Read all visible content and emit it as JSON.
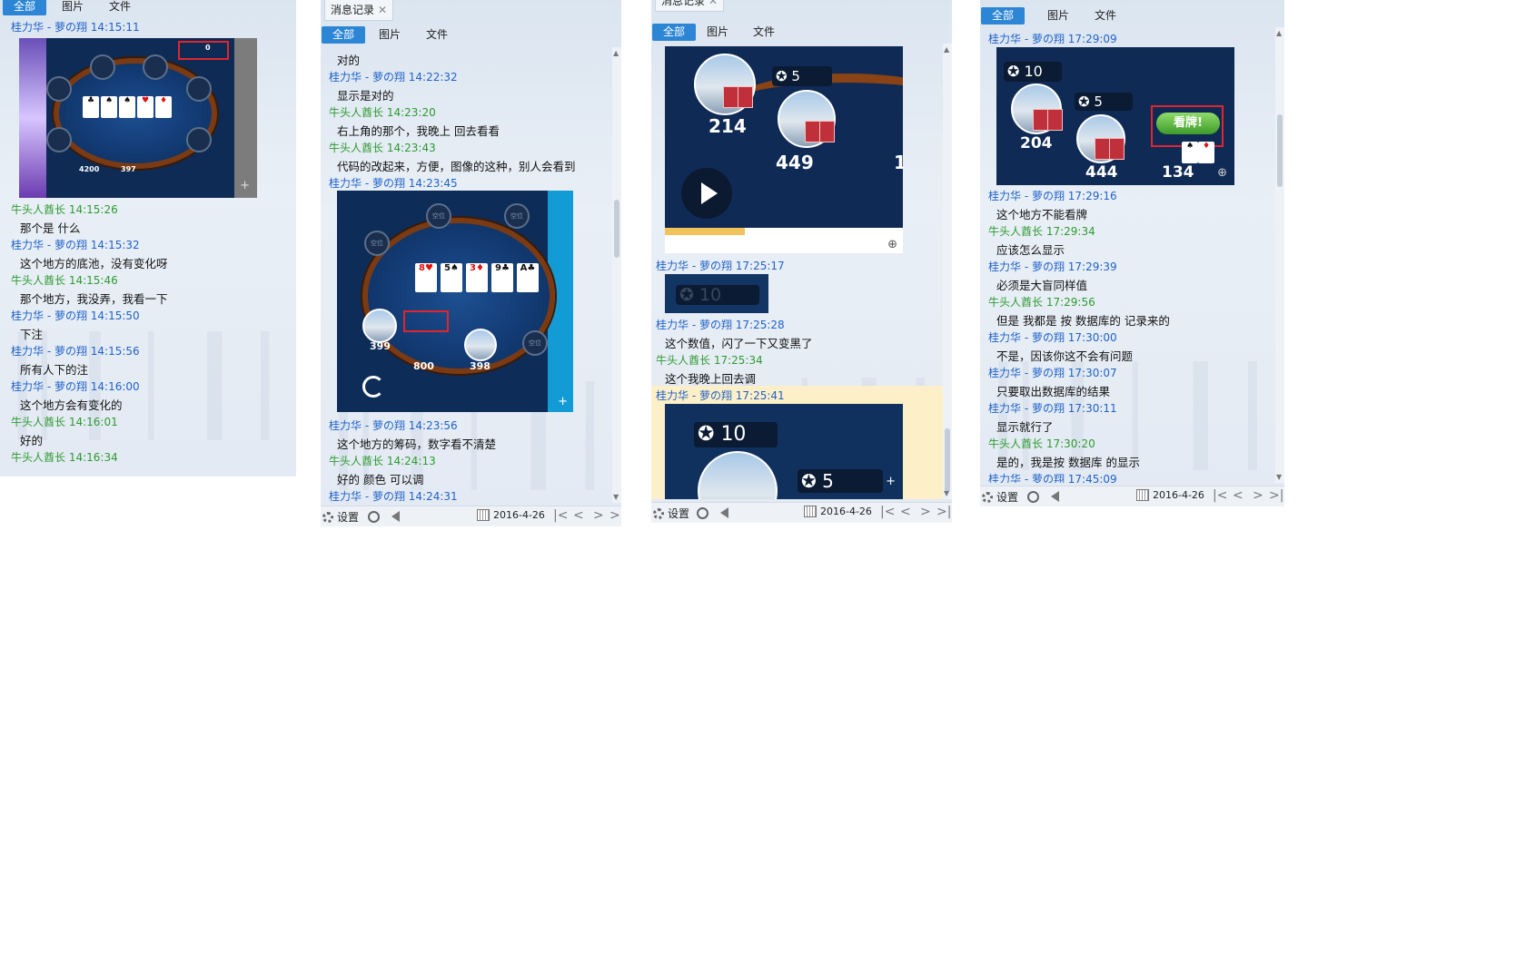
{
  "panels": [
    {
      "title": "",
      "tabs": [
        "全部",
        "图片",
        "文件"
      ],
      "messages": [
        {
          "sender": "桂力华 - 萝の翔 14:15:11",
          "text": ""
        },
        {
          "sender": "牛头人酋长 14:15:26",
          "text": "那个是 什么"
        },
        {
          "sender": "桂力华 - 萝の翔 14:15:32",
          "text": "这个地方的底池，没有变化呀"
        },
        {
          "sender": "牛头人酋长 14:15:46",
          "text": "那个地方，我没弄，我看一下"
        },
        {
          "sender": "桂力华 - 萝の翔 14:15:50",
          "text": "下注"
        },
        {
          "sender": "桂力华 - 萝の翔 14:15:56",
          "text": "所有人下的注"
        },
        {
          "sender": "桂力华 - 萝の翔 14:16:00",
          "text": "这个地方会有变化的"
        },
        {
          "sender": "牛头人酋长 14:16:01",
          "text": "好的"
        },
        {
          "sender": "牛头人酋长 14:16:34",
          "text": ""
        }
      ],
      "image": {
        "chip_total": "4200",
        "pot": "397",
        "topbox": "0"
      }
    },
    {
      "title": "消息记录",
      "tabs": [
        "全部",
        "图片",
        "文件"
      ],
      "messages": [
        {
          "sender": "",
          "text": "对的"
        },
        {
          "sender": "桂力华 - 萝の翔 14:22:32",
          "text": "显示是对的"
        },
        {
          "sender": "牛头人酋长 14:23:20",
          "text": "右上角的那个，我晚上 回去看看"
        },
        {
          "sender": "牛头人酋长 14:23:43",
          "text": "代码的改起来，方便，图像的这种，别人会看到"
        },
        {
          "sender": "桂力华 - 萝の翔 14:23:45",
          "text": ""
        },
        {
          "sender": "桂力华 - 萝の翔 14:23:56",
          "text": "这个地方的筹码，数字看不清楚"
        },
        {
          "sender": "牛头人酋长 14:24:13",
          "text": "好的 颜色 可以调"
        },
        {
          "sender": "桂力华 - 萝の翔 14:24:31",
          "text": ""
        }
      ],
      "image": {
        "seat_label": "空位",
        "p1": "399",
        "p2": "800",
        "p3": "398",
        "cards": [
          "8♥",
          "5♠",
          "3♦",
          "9♣",
          "A♣"
        ]
      },
      "footer": {
        "settings": "设置",
        "date": "2016-4-26"
      }
    },
    {
      "title": "消息记录",
      "tabs": [
        "全部",
        "图片",
        "文件"
      ],
      "messages": [
        {
          "sender": "桂力华 - 萝の翔 17:25:17",
          "text": ""
        },
        {
          "sender": "桂力华 - 萝の翔 17:25:28",
          "text": "这个数值，闪了一下又变黑了"
        },
        {
          "sender": "牛头人酋长 17:25:34",
          "text": "这个我晚上回去调"
        },
        {
          "sender": "桂力华 - 萝の翔 17:25:41",
          "text": ""
        }
      ],
      "image_top": {
        "a": "214",
        "b": "449",
        "c": "1",
        "chip": "5"
      },
      "image_small": {
        "chip": "10"
      },
      "image_bottom": {
        "chip1": "10",
        "chip2": "5"
      },
      "footer": {
        "settings": "设置",
        "date": "2016-4-26"
      }
    },
    {
      "title": "",
      "tabs": [
        "全部",
        "图片",
        "文件"
      ],
      "messages": [
        {
          "sender": "桂力华 - 萝の翔 17:29:09",
          "text": ""
        },
        {
          "sender": "桂力华 - 萝の翔 17:29:16",
          "text": "这个地方不能看牌"
        },
        {
          "sender": "牛头人酋长 17:29:34",
          "text": "应该怎么显示"
        },
        {
          "sender": "桂力华 - 萝の翔 17:29:39",
          "text": "必须是大盲同样值"
        },
        {
          "sender": "牛头人酋长 17:29:56",
          "text": "但是 我都是 按 数据库的 记录来的"
        },
        {
          "sender": "桂力华 - 萝の翔 17:30:00",
          "text": "不是，因该你这不会有问题"
        },
        {
          "sender": "桂力华 - 萝の翔 17:30:07",
          "text": "只要取出数据库的结果"
        },
        {
          "sender": "桂力华 - 萝の翔 17:30:11",
          "text": "显示就行了"
        },
        {
          "sender": "牛头人酋长 17:30:20",
          "text": "是的，我是按 数据库 的显示"
        },
        {
          "sender": "桂力华 - 萝の翔 17:45:09",
          "text": ""
        }
      ],
      "image": {
        "chip1": "10",
        "chip2": "5",
        "a": "204",
        "b": "444",
        "c": "134",
        "btn": "看牌!"
      },
      "footer": {
        "settings": "设置",
        "date": "2016-4-26"
      }
    }
  ],
  "colors": {
    "accent": "#2c86d5",
    "sender_a": "#1f62c9",
    "sender_b": "#2e9a31",
    "highlight": "#fdefc8"
  }
}
